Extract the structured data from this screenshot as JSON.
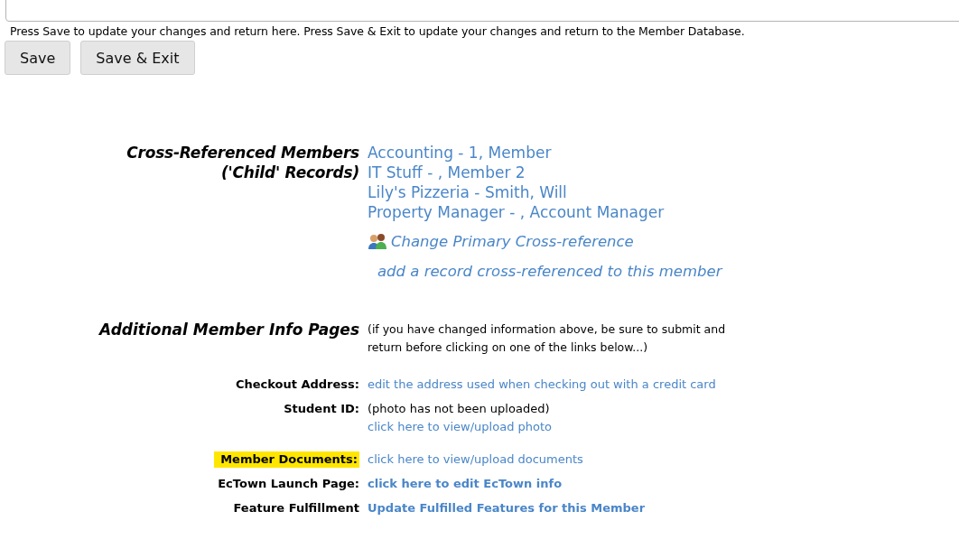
{
  "instructions": "Press Save to update your changes and return here. Press Save & Exit to update your changes and return to the Member Database.",
  "buttons": [
    "Save",
    "Save & Exit"
  ],
  "cross_references": {
    "title_lines": [
      "Cross-Referenced Members",
      "('Child' Records)"
    ],
    "members": [
      "Accounting - 1, Member",
      "IT Stuff - , Member 2",
      "Lily's Pizzeria - Smith, Will",
      "Property Manager - , Account Manager"
    ],
    "change_link": "Change Primary Cross-reference",
    "add_link": "add a record cross-referenced to this member"
  },
  "info_pages": {
    "title": "Additional Member Info Pages",
    "note": "(if you have changed information above, be sure to submit and return before clicking on one of the links below...)"
  },
  "info_groups": [
    [
      {
        "label": "Checkout Address:",
        "highlighted": false,
        "values": [
          {
            "kind": "link",
            "text": "edit the address used when checking out with a credit card"
          }
        ]
      },
      {
        "label": "Student ID:",
        "highlighted": false,
        "values": [
          {
            "kind": "text",
            "text": "(photo has not been uploaded)"
          },
          {
            "kind": "link",
            "text": "click here to view/upload photo"
          }
        ]
      }
    ],
    [
      {
        "label": "Member Documents:",
        "highlighted": true,
        "values": [
          {
            "kind": "link",
            "text": "click here to view/upload documents"
          }
        ]
      },
      {
        "label": "EcTown Launch Page:",
        "highlighted": false,
        "values": [
          {
            "kind": "bold-link",
            "text": "click here to edit EcTown info"
          }
        ]
      },
      {
        "label": "Feature Fulfillment",
        "highlighted": false,
        "values": [
          {
            "kind": "bold-link",
            "text": "Update Fulfilled Features for this Member"
          }
        ]
      }
    ]
  ]
}
